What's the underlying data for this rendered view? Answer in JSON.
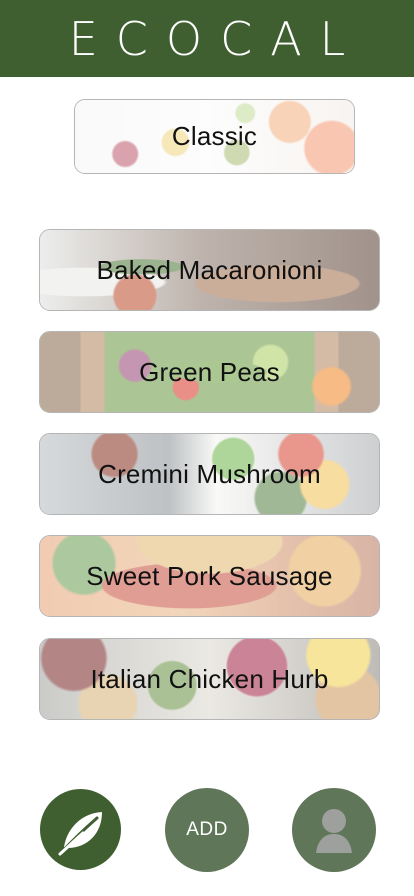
{
  "header": {
    "title": "ECOCAL"
  },
  "classic_button": {
    "label": "Classic"
  },
  "recipes": [
    {
      "label": "Baked Macaronioni"
    },
    {
      "label": "Green Peas"
    },
    {
      "label": "Cremini Mushroom"
    },
    {
      "label": "Sweet Pork Sausage"
    },
    {
      "label": "Italian Chicken Hurb"
    }
  ],
  "bottom_nav": {
    "home_icon": "leaf-icon",
    "add_label": "ADD",
    "profile_icon": "user-icon"
  },
  "colors": {
    "header_bg": "#3f5f31",
    "primary_button": "#3f5f31",
    "secondary_button": "#5f7659",
    "text": "#111111",
    "border": "#b5b5b5"
  }
}
